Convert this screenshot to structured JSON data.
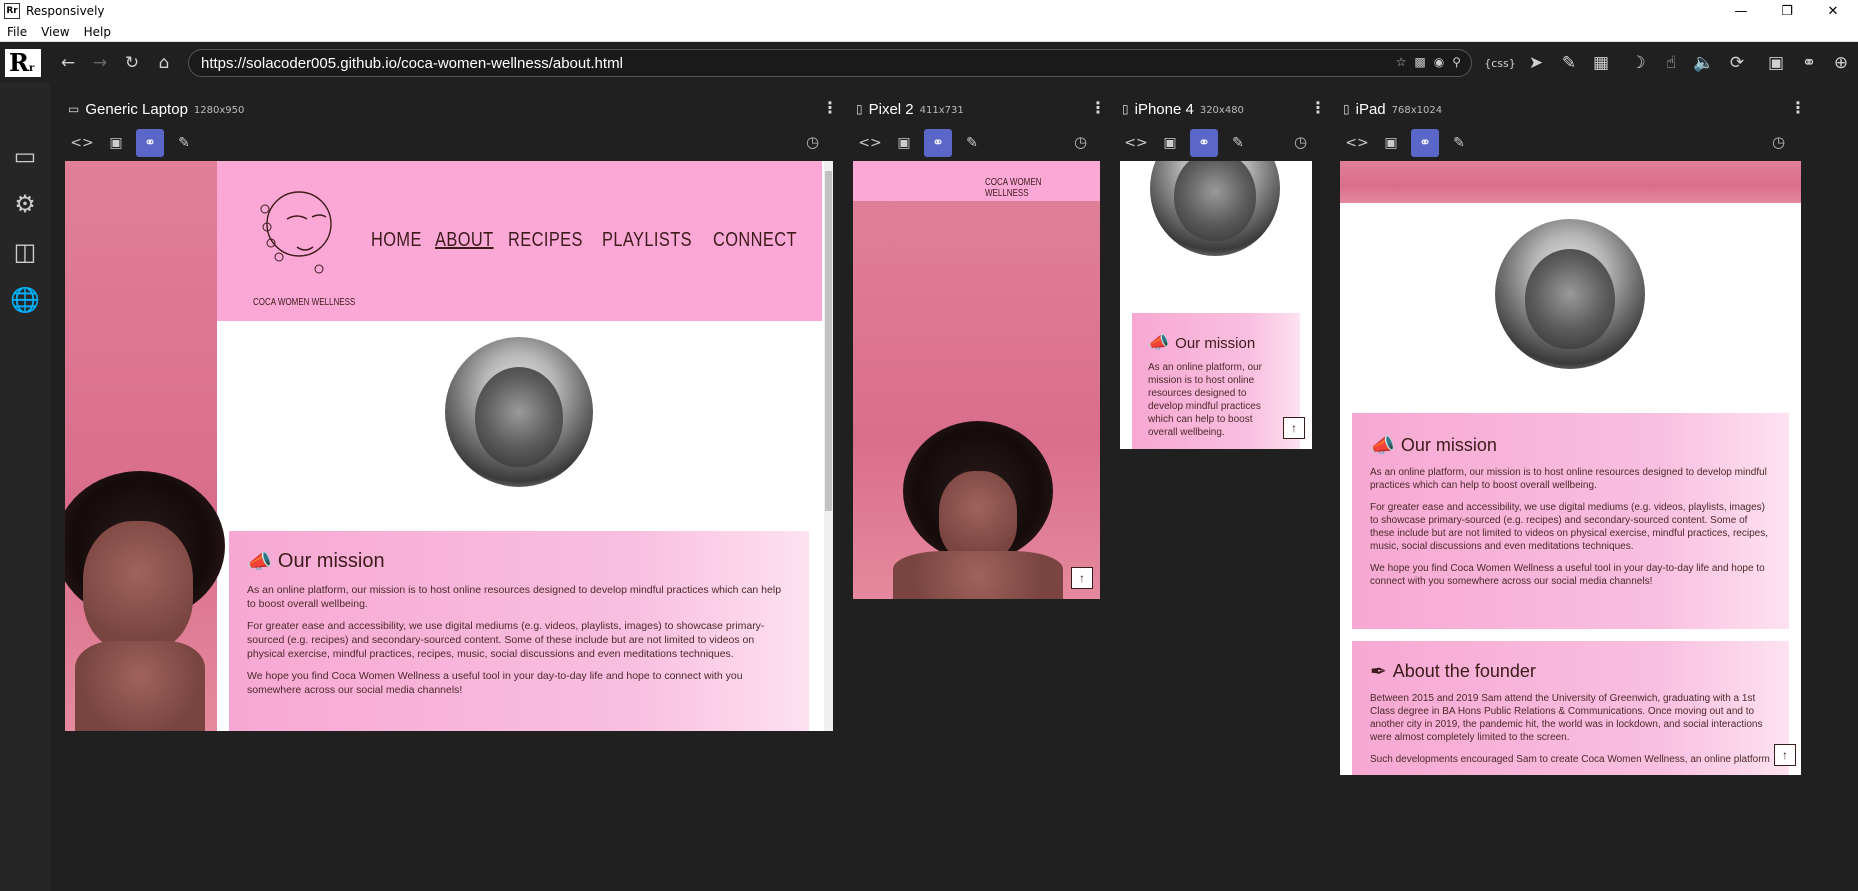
{
  "window": {
    "title": "Responsively",
    "app_icon": "Rr"
  },
  "menu": [
    "File",
    "View",
    "Help"
  ],
  "address": {
    "url": "https://solacoder005.github.io/coca-women-wellness/about.html"
  },
  "toolbar_right": {
    "css_label": "{css}"
  },
  "devices": [
    {
      "name": "Generic Laptop",
      "size": "1280x950"
    },
    {
      "name": "Pixel 2",
      "size": "411x731"
    },
    {
      "name": "iPhone 4",
      "size": "320x480"
    },
    {
      "name": "iPad",
      "size": "768x1024"
    }
  ],
  "site": {
    "brand": "COCA WOMEN WELLNESS",
    "nav": [
      "HOME",
      "ABOUT",
      "RECIPES",
      "PLAYLISTS",
      "CONNECT"
    ],
    "mission": {
      "title": "Our mission",
      "p1": "As an online platform, our mission is to host online resources designed to develop mindful practices which can help to boost overall wellbeing.",
      "p2": "For greater ease and accessibility, we use digital mediums (e.g. videos, playlists, images) to showcase primary-sourced (e.g. recipes) and secondary-sourced content. Some of these include but are not limited to videos on physical exercise, mindful practices, recipes, music, social discussions and even meditations techniques.",
      "p3": "We hope you find Coca Women Wellness a useful tool in your day-to-day life and hope to connect with you somewhere across our social media channels!"
    },
    "founder": {
      "title": "About the founder",
      "p1": "Between 2015 and 2019 Sam attend the University of Greenwich, graduating with a 1st Class degree in BA Hons Public Relations & Communications. Once moving out and to another city in 2019, the pandemic hit, the world was in lockdown, and social interactions were almost completely limited to the screen.",
      "p2": "Such developments encouraged Sam to create Coca Women Wellness, an online platform"
    },
    "iphone_mission_snippet": "As an online platform, our mission is to host online resources designed to develop mindful practices which can help to boost overall wellbeing."
  },
  "colors": {
    "accent": "#5a66c8",
    "site_pink": "#fca8d6",
    "site_text": "#3c1b1b",
    "bg": "#202020"
  },
  "icons": {
    "sidebar": [
      "devices-icon",
      "settings-gear-icon",
      "extensions-puzzle-icon",
      "globe-icon"
    ],
    "device_tools": [
      "code-icon",
      "screenshot-icon",
      "link-sync-icon",
      "edit-icon"
    ]
  }
}
